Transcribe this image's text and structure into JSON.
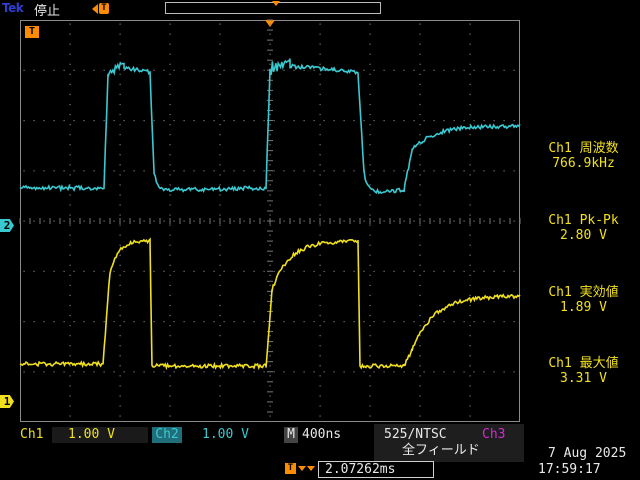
{
  "header": {
    "brand": "Tek",
    "run_state": "停止",
    "trigger_position_badge": "T"
  },
  "graticule": {
    "trigger_marker": "T",
    "channel_markers": {
      "ch2": "2",
      "ch1": "1"
    },
    "colors": {
      "ch1": "#f1e01e",
      "ch2": "#3ac9d1",
      "trigger": "#ff8c00",
      "grid": "#8a8a8a"
    }
  },
  "measurements": [
    {
      "label": "Ch1 周波数",
      "value": "766.9kHz"
    },
    {
      "label": "Ch1 Pk-Pk",
      "value": "2.80 V"
    },
    {
      "label": "Ch1 実効値",
      "value": "1.89 V"
    },
    {
      "label": "Ch1 最大値",
      "value": "3.31 V"
    }
  ],
  "status": {
    "ch1_label": "Ch1",
    "ch1_scale": "1.00 V",
    "ch2_label": "Ch2",
    "ch2_scale": "1.00 V",
    "timebase_prefix": "M",
    "timebase": "400ns",
    "trigger_standard": "525/NTSC",
    "trigger_source": "Ch3",
    "trigger_field": "全フィールド",
    "horizontal_position": "2.07262ms",
    "date": "7 Aug 2025",
    "time": "17:59:17"
  }
}
